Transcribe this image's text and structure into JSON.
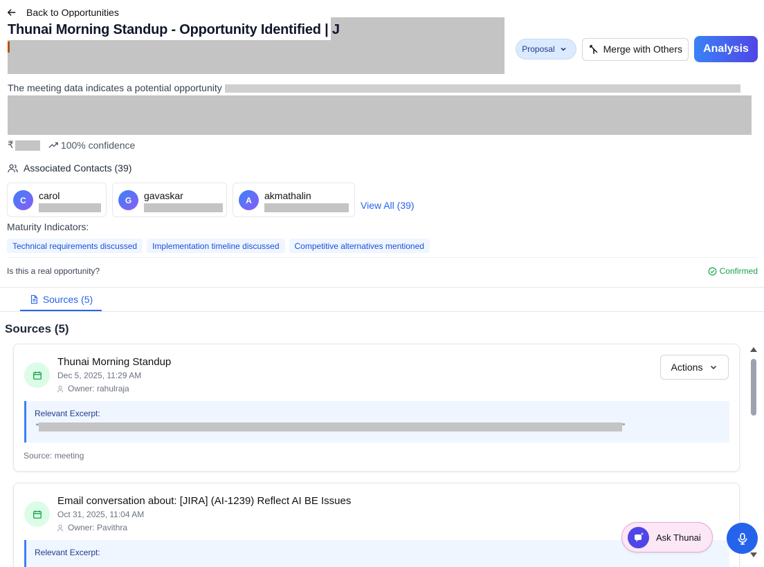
{
  "nav": {
    "back_label": "Back to Opportunities"
  },
  "header": {
    "title": "Thunai Morning Standup - Opportunity Identified | J",
    "description_start": "The meeting data indicates a potential opportunity",
    "rupee": "₹",
    "confidence": "100% confidence"
  },
  "toolbar": {
    "status_label": "Proposal",
    "merge_label": "Merge with Others",
    "analysis_label": "Analysis"
  },
  "contacts": {
    "heading": "Associated Contacts (39)",
    "items": [
      {
        "initial": "C",
        "name": "carol"
      },
      {
        "initial": "G",
        "name": "gavaskar"
      },
      {
        "initial": "A",
        "name": "akmathalin"
      }
    ],
    "view_all": "View All (39)"
  },
  "maturity": {
    "label": "Maturity Indicators:",
    "chips": [
      "Technical requirements discussed",
      "Implementation timeline discussed",
      "Competitive alternatives mentioned"
    ]
  },
  "validation": {
    "question": "Is this a real opportunity?",
    "status": "Confirmed",
    "status_color": "#16a34a"
  },
  "tabs": [
    {
      "label": "Sources (5)"
    }
  ],
  "sources": {
    "heading": "Sources (5)",
    "actions_label": "Actions",
    "excerpt_label": "Relevant Excerpt:",
    "items": [
      {
        "title": "Thunai Morning Standup",
        "date": "Dec 5, 2025, 11:29 AM",
        "owner": "Owner: rahulraja",
        "source": "Source: meeting"
      },
      {
        "title": "Email conversation about: [JIRA] (AI-1239) Reflect AI BE Issues",
        "date": "Oct 31, 2025, 11:04 AM",
        "owner": "Owner: Pavithra"
      }
    ]
  },
  "assistant": {
    "ask_label": "Ask Thunai"
  },
  "colors": {
    "accent": "#2563eb",
    "brand_gradient_start": "#3b82f6",
    "brand_gradient_end": "#4f46e5"
  }
}
